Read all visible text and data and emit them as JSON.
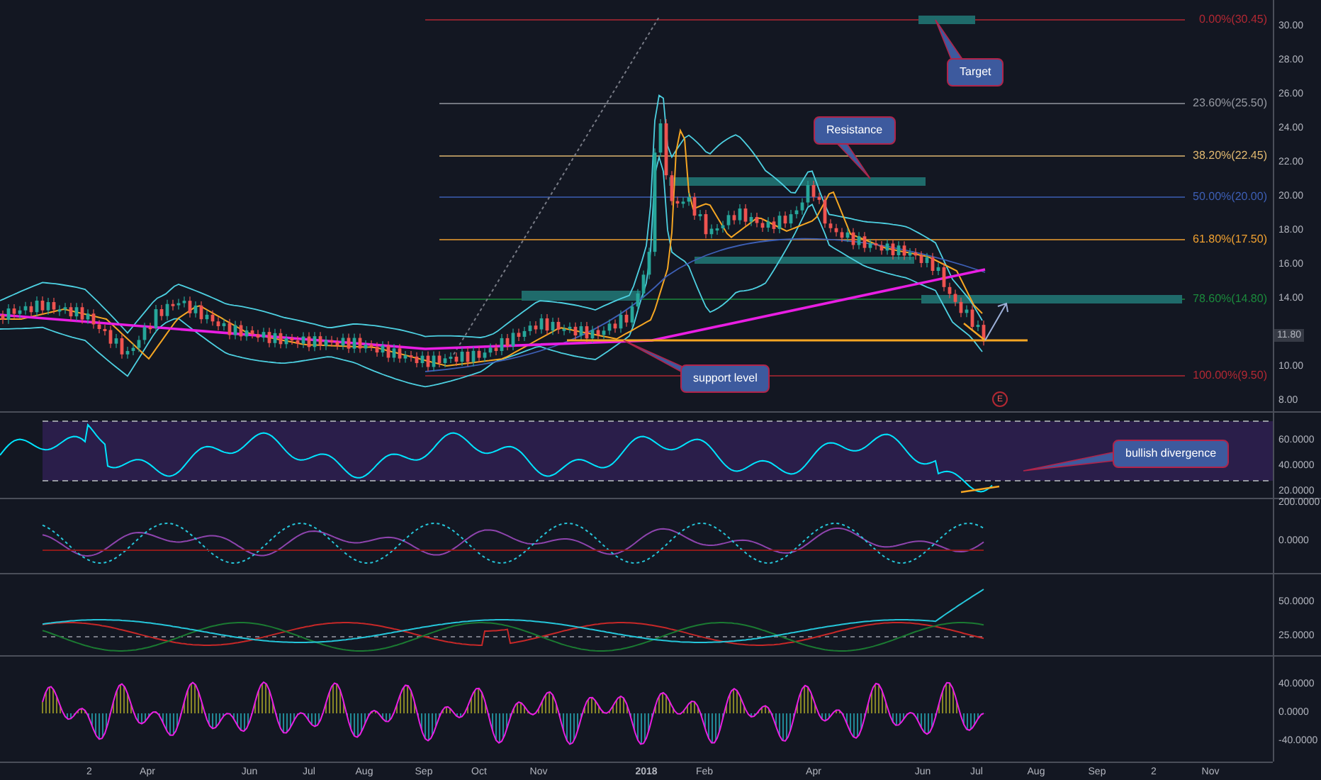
{
  "price_pane": {
    "ticks": [
      "30.00",
      "28.00",
      "26.00",
      "24.00",
      "22.00",
      "20.00",
      "18.00",
      "16.00",
      "14.00",
      "10.00",
      "8.00"
    ],
    "last_price": "11.80",
    "fib_levels": [
      {
        "label": "0.00%(30.45)",
        "color": "#b22833"
      },
      {
        "label": "23.60%(25.50)",
        "color": "#9598a1"
      },
      {
        "label": "38.20%(22.45)",
        "color": "#e0b870"
      },
      {
        "label": "50.00%(20.00)",
        "color": "#3d5fb5"
      },
      {
        "label": "61.80%(17.50)",
        "color": "#f0a030"
      },
      {
        "label": "78.60%(14.80)",
        "color": "#1b8a3c"
      },
      {
        "label": "100.00%(9.50)",
        "color": "#b22833"
      }
    ],
    "callouts": [
      {
        "text": "Target"
      },
      {
        "text": "Resistance"
      },
      {
        "text": "support level"
      }
    ],
    "event_marker": "E"
  },
  "rsi_pane": {
    "ticks": [
      "60.0000",
      "40.0000",
      "20.0000"
    ],
    "callout": "bullish divergence"
  },
  "macd_pane": {
    "ticks": [
      "200.0000",
      "0.0000"
    ]
  },
  "dmi_pane": {
    "ticks": [
      "50.0000",
      "25.0000"
    ]
  },
  "oscillator_pane": {
    "ticks": [
      "40.0000",
      "0.0000",
      "-40.0000"
    ]
  },
  "time_axis": {
    "labels": [
      {
        "text": "2",
        "bold": false
      },
      {
        "text": "Apr",
        "bold": false
      },
      {
        "text": "Jun",
        "bold": false
      },
      {
        "text": "Jul",
        "bold": false
      },
      {
        "text": "Aug",
        "bold": false
      },
      {
        "text": "Sep",
        "bold": false
      },
      {
        "text": "Oct",
        "bold": false
      },
      {
        "text": "Nov",
        "bold": false
      },
      {
        "text": "2018",
        "bold": true
      },
      {
        "text": "Feb",
        "bold": false
      },
      {
        "text": "Apr",
        "bold": false
      },
      {
        "text": "Jun",
        "bold": false
      },
      {
        "text": "Jul",
        "bold": false
      },
      {
        "text": "Aug",
        "bold": false
      },
      {
        "text": "Sep",
        "bold": false
      },
      {
        "text": "2",
        "bold": false
      },
      {
        "text": "Nov",
        "bold": false
      }
    ]
  }
}
